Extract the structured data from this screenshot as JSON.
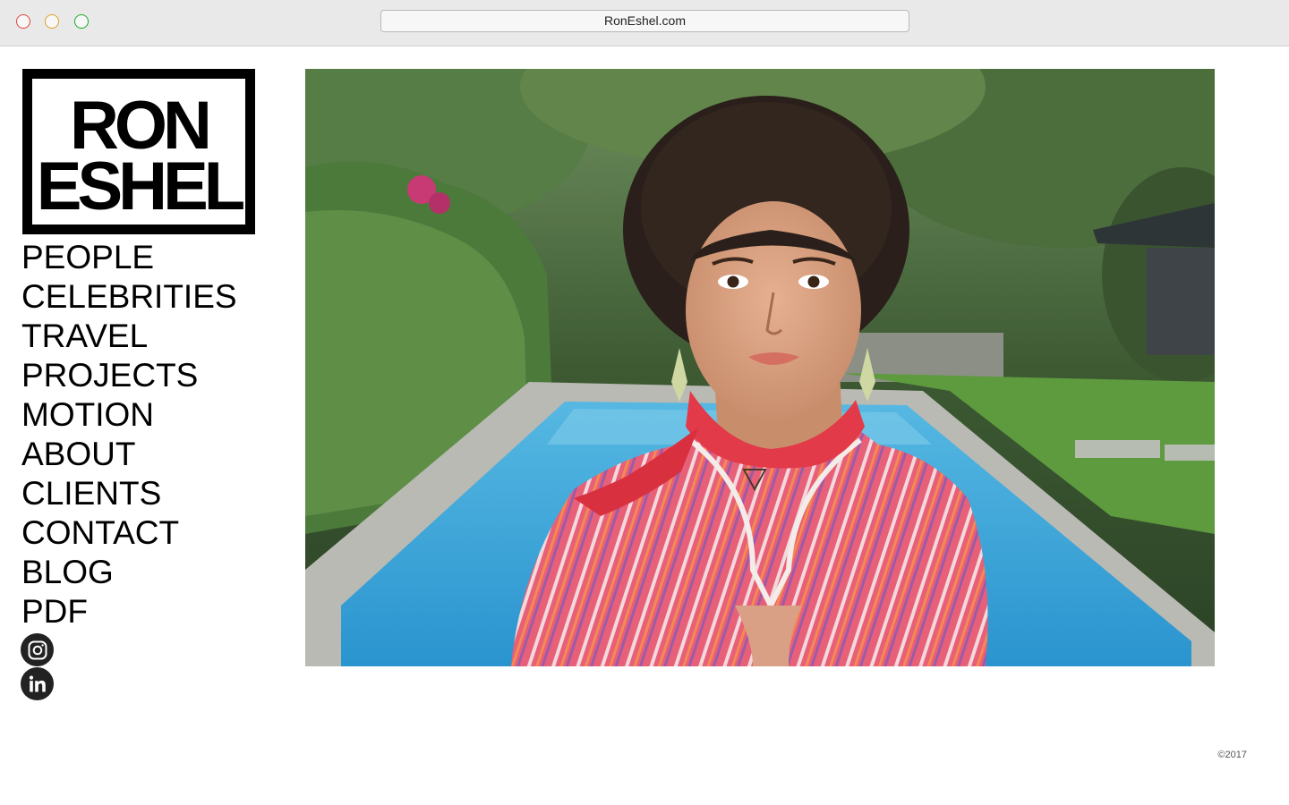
{
  "browser": {
    "url": "RonEshel.com"
  },
  "logo": {
    "line1": "RON",
    "line2": "ESHEL"
  },
  "nav": {
    "items": [
      {
        "label": "PEOPLE"
      },
      {
        "label": "CELEBRITIES"
      },
      {
        "label": "TRAVEL"
      },
      {
        "label": "PROJECTS"
      },
      {
        "label": "MOTION"
      },
      {
        "label": "ABOUT"
      },
      {
        "label": "CLIENTS"
      },
      {
        "label": "CONTACT"
      },
      {
        "label": "BLOG"
      },
      {
        "label": "PDF"
      }
    ]
  },
  "social": {
    "instagram_icon": "instagram-icon",
    "linkedin_icon": "linkedin-icon"
  },
  "hero": {
    "alt": "Portrait of a woman in a pink striped top and red scarf beside a swimming pool"
  },
  "footer": {
    "copyright": "©2017"
  }
}
